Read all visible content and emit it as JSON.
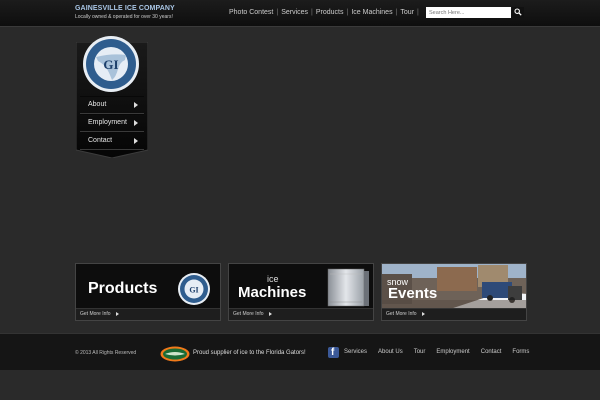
{
  "header": {
    "brand_title": "GAINESVILLE ICE COMPANY",
    "brand_tagline": "Locally owned & operated for over 30 years!",
    "nav": [
      "Photo Contest",
      "Services",
      "Products",
      "Ice Machines",
      "Tour"
    ],
    "search_placeholder": "Search Here..."
  },
  "sidebar": {
    "logo_text": "GI",
    "items": [
      {
        "label": "About"
      },
      {
        "label": "Employment"
      },
      {
        "label": "Contact"
      }
    ]
  },
  "tiles": [
    {
      "title": "Products",
      "more": "Get More Info"
    },
    {
      "small": "ice",
      "title": "Machines",
      "more": "Get More Info"
    },
    {
      "small": "snow",
      "title": "Events",
      "more": "Get More Info"
    }
  ],
  "footer": {
    "copyright": "© 2013 All Rights Reserved",
    "supplier": "Proud supplier of ice to the Florida Gators!",
    "links": [
      "Services",
      "About Us",
      "Tour",
      "Employment",
      "Contact",
      "Forms"
    ]
  },
  "colors": {
    "brand_title": "#a9c6e6",
    "background": "#2a2a2a",
    "facebook": "#3b5998"
  }
}
